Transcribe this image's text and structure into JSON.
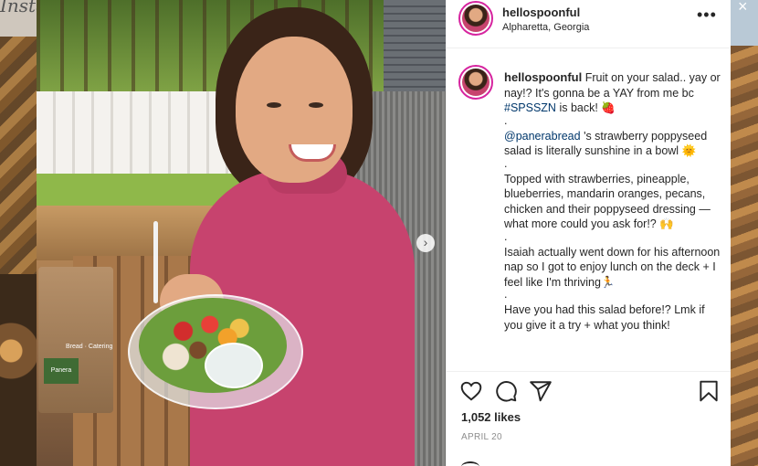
{
  "background": {
    "partial_title": "Instag"
  },
  "post": {
    "username": "hellospoonful",
    "location": "Alpharetta, Georgia",
    "caption": {
      "intro": "Fruit on your salad.. yay or nay!? It's gonna be a YAY from me bc ",
      "hashtag": "#SPSSZN",
      "intro_end": " is back! 🍓",
      "dot1": ".",
      "mention": "@panerabread",
      "para2": " 's strawberry poppyseed salad is literally sunshine in a bowl 🌞",
      "dot2": ".",
      "para3": "Topped with strawberries, pineapple, blueberries, mandarin oranges, pecans, chicken and their poppyseed dressing — what more could you ask for!? 🙌",
      "dot3": ".",
      "para4": "Isaiah actually went down for his afternoon nap so I got to enjoy lunch on the deck + I feel like I'm thriving🏃",
      "dot4": ".",
      "para5": "Have you had this salad before!? Lmk if you give it a try + what you think!"
    },
    "likes": "1,052 likes",
    "date": "APRIL 20",
    "bag_text": "Bread · Catering",
    "bag_logo": "Panera"
  },
  "icons": {
    "more": "more-options-icon",
    "like": "heart-icon",
    "comment": "comment-icon",
    "share": "share-icon",
    "save": "bookmark-icon",
    "next": "chevron-right-icon",
    "close": "close-icon"
  },
  "colors": {
    "username": "#262626",
    "link": "#00376b",
    "muted": "#8e8e8e",
    "story_ring": "#d6249f",
    "sweater": "#c7436e"
  }
}
